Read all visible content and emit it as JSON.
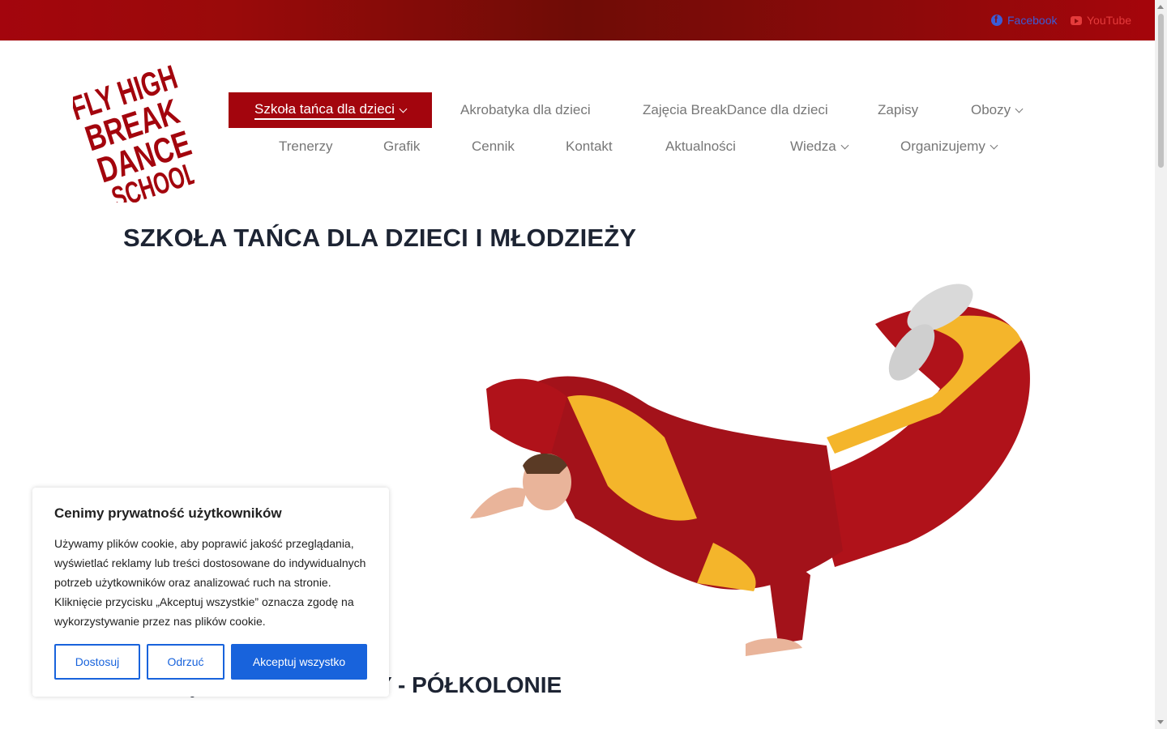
{
  "topbar": {
    "facebook_label": "Facebook",
    "youtube_label": "YouTube"
  },
  "logo": {
    "lines": [
      "FLY HIGH",
      "BREAK",
      "DANCE",
      "SCHOOL"
    ],
    "color": "#a3050d"
  },
  "nav": {
    "row1": [
      {
        "label": "Szkoła tańca dla dzieci",
        "dropdown": true,
        "active": true
      },
      {
        "label": "Akrobatyka dla dzieci"
      },
      {
        "label": "Zajęcia BreakDance dla dzieci"
      },
      {
        "label": "Zapisy"
      },
      {
        "label": "Obozy",
        "dropdown": true
      }
    ],
    "row2": [
      {
        "label": "Trenerzy"
      },
      {
        "label": "Grafik"
      },
      {
        "label": "Cennik"
      },
      {
        "label": "Kontakt"
      },
      {
        "label": "Aktualności"
      },
      {
        "label": "Wiedza",
        "dropdown": true
      },
      {
        "label": "Organizujemy",
        "dropdown": true
      }
    ]
  },
  "main": {
    "title": "SZKOŁA TAŃCA DLA DZIECI I MŁODZIEŻY",
    "section_title": "ZAJĘCIA - WARSZTATY - PÓŁKOLONIE"
  },
  "cookie": {
    "title": "Cenimy prywatność użytkowników",
    "text": "Używamy plików cookie, aby poprawić jakość przeglądania, wyświetlać reklamy lub treści dostosowane do indywidualnych potrzeb użytkowników oraz analizować ruch na stronie. Kliknięcie przycisku „Akceptuj wszystkie” oznacza zgodę na wykorzystywanie przez nas plików cookie.",
    "customize_label": "Dostosuj",
    "reject_label": "Odrzuć",
    "accept_label": "Akceptuj wszystko"
  },
  "colors": {
    "brand": "#a3050d",
    "accent": "#1863dc",
    "heading": "#1d2433"
  },
  "icons": [
    "facebook-icon",
    "youtube-icon",
    "chevron-down-icon"
  ]
}
